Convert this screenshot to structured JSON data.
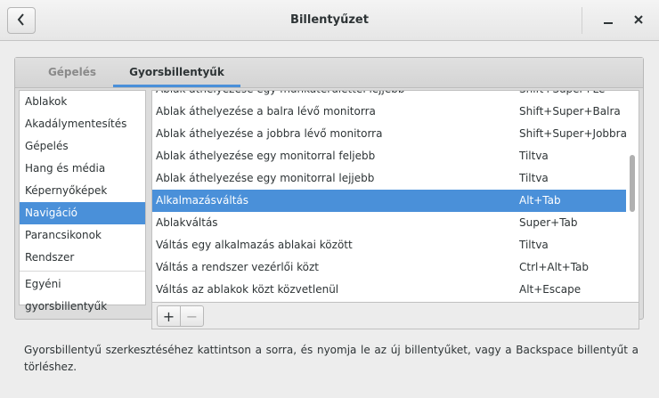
{
  "window": {
    "title": "Billentyűzet",
    "back_icon": "chevron-left-icon",
    "minimize_icon": "minimize-icon",
    "close_icon": "close-icon"
  },
  "tabs": [
    {
      "label": "Gépelés",
      "active": false
    },
    {
      "label": "Gyorsbillentyűk",
      "active": true
    }
  ],
  "sidebar": {
    "items": [
      {
        "label": "Ablakok"
      },
      {
        "label": "Akadálymentesítés"
      },
      {
        "label": "Gépelés"
      },
      {
        "label": "Hang és média"
      },
      {
        "label": "Képernyőképek"
      },
      {
        "label": "Navigáció",
        "selected": true
      },
      {
        "label": "Parancsikonok"
      },
      {
        "label": "Rendszer"
      }
    ],
    "custom": {
      "label": "Egyéni gyorsbillentyűk"
    }
  },
  "shortcuts": [
    {
      "name": "Ablak áthelyezése egy munkaterülettel lejjebb",
      "key": "Shift+Super+Le"
    },
    {
      "name": "Ablak áthelyezése a balra lévő monitorra",
      "key": "Shift+Super+Balra"
    },
    {
      "name": "Ablak áthelyezése a jobbra lévő monitorra",
      "key": "Shift+Super+Jobbra"
    },
    {
      "name": "Ablak áthelyezése egy monitorral feljebb",
      "key": "Tiltva"
    },
    {
      "name": "Ablak áthelyezése egy monitorral lejjebb",
      "key": "Tiltva"
    },
    {
      "name": "Alkalmazásváltás",
      "key": "Alt+Tab",
      "selected": true
    },
    {
      "name": "Ablakváltás",
      "key": "Super+Tab"
    },
    {
      "name": "Váltás egy alkalmazás ablakai között",
      "key": "Tiltva"
    },
    {
      "name": "Váltás a rendszer vezérlői közt",
      "key": "Ctrl+Alt+Tab"
    },
    {
      "name": "Váltás az ablakok közt közvetlenül",
      "key": "Alt+Escape"
    }
  ],
  "toolbar": {
    "add_label": "+",
    "remove_label": "−"
  },
  "help_text": "Gyorsbillentyű szerkesztéséhez kattintson a sorra, és nyomja le az új billentyűket, vagy a Backspace billentyűt a törléshez.",
  "colors": {
    "accent": "#4a90d9"
  }
}
